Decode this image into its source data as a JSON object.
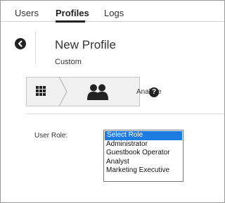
{
  "tabs": [
    {
      "label": "Users"
    },
    {
      "label": "Profiles"
    },
    {
      "label": "Logs"
    }
  ],
  "active_tab": "Profiles",
  "header": {
    "title": "New Profile",
    "subtitle": "Custom"
  },
  "breadcrumb": {
    "root_icon": "grid-icon",
    "current_icon": "users-icon",
    "current_label": "Analyze"
  },
  "help": {
    "icon": "help-icon",
    "glyph": "?"
  },
  "role_field": {
    "label": "User Role:",
    "selected": "Select Role",
    "options": [
      "Select Role",
      "Administrator",
      "Guestbook Operator",
      "Analyst",
      "Marketing Executive"
    ]
  },
  "colors": {
    "selection": "#1e7be0",
    "dark_icon": "#222222"
  }
}
